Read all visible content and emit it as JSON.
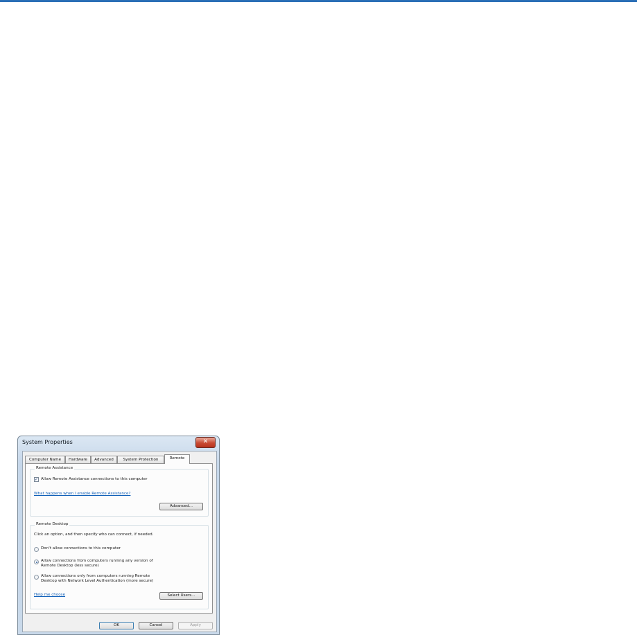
{
  "window": {
    "title": "System Properties",
    "close_glyph": "✕"
  },
  "tabs": [
    {
      "label": "Computer Name",
      "active": false
    },
    {
      "label": "Hardware",
      "active": false
    },
    {
      "label": "Advanced",
      "active": false
    },
    {
      "label": "System Protection",
      "active": false
    },
    {
      "label": "Remote",
      "active": true
    }
  ],
  "remote_assistance": {
    "group_title": "Remote Assistance",
    "allow_label": "Allow Remote Assistance connections to this computer",
    "allow_checked": true,
    "check_glyph": "✓",
    "help_link": "What happens when I enable Remote Assistance?",
    "advanced_button": "Advanced..."
  },
  "remote_desktop": {
    "group_title": "Remote Desktop",
    "instruction": "Click an option, and then specify who can connect, if needed.",
    "options": [
      {
        "line1": "Don't allow connections to this computer",
        "line2": "",
        "selected": false
      },
      {
        "line1": "Allow connections from computers running any version of",
        "line2": "Remote Desktop (less secure)",
        "selected": true
      },
      {
        "line1": "Allow connections only from computers running Remote",
        "line2": "Desktop with Network Level Authentication (more secure)",
        "selected": false
      }
    ],
    "help_link": "Help me choose",
    "select_users_button": "Select Users..."
  },
  "footer": {
    "ok": "OK",
    "cancel": "Cancel",
    "apply": "Apply"
  },
  "colors": {
    "top_rule": "#2b6fb6",
    "link": "#0f5fb8",
    "close_button": "#c84a33"
  }
}
